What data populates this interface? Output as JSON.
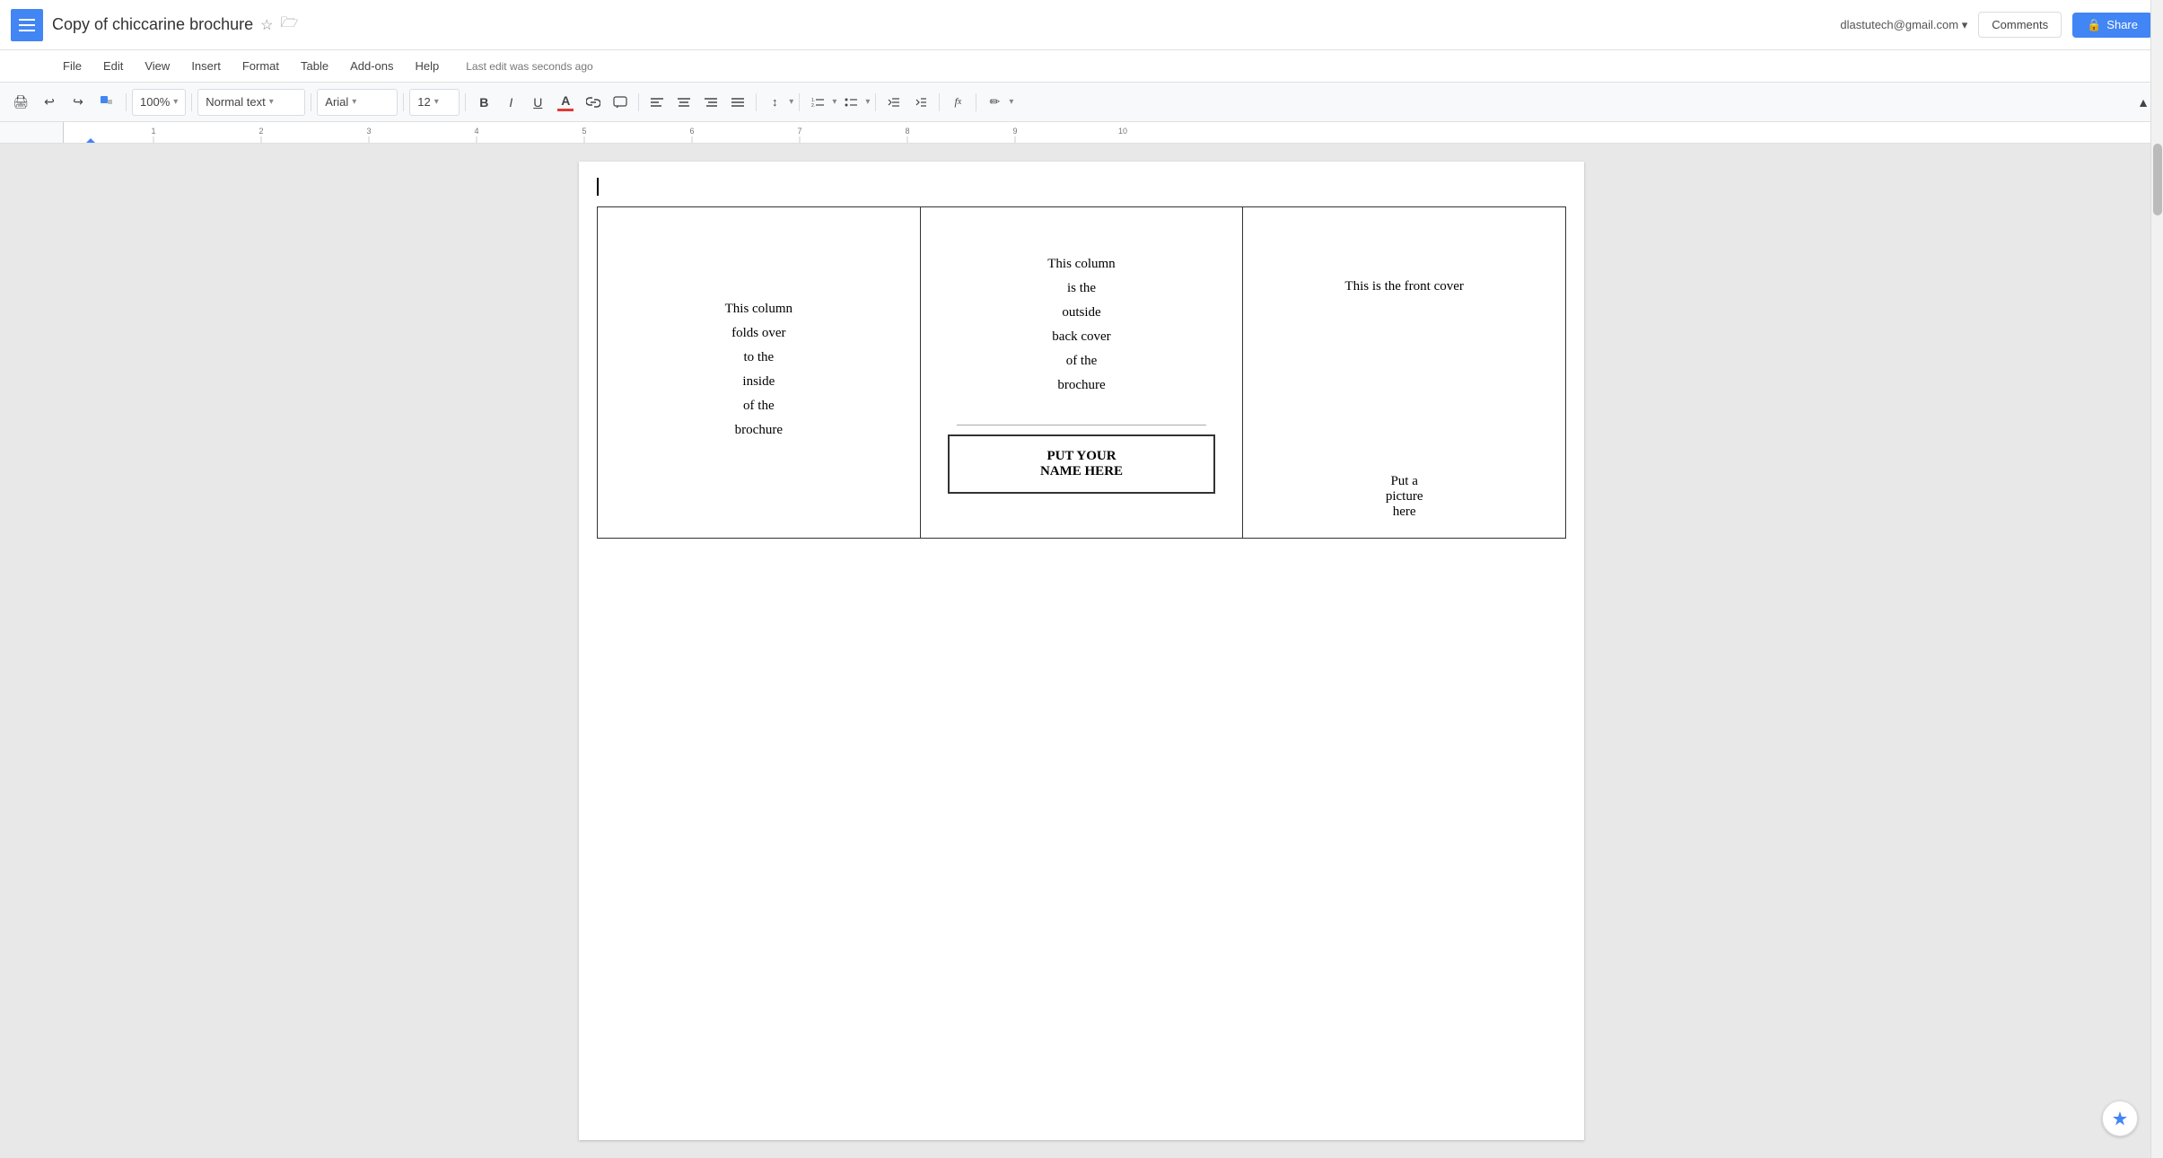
{
  "app": {
    "menu_icon": "≡",
    "title": "Copy of chiccarine brochure",
    "star": "☆",
    "folder": "🗁"
  },
  "topRight": {
    "user_email": "dlastutech@gmail.com",
    "email_arrow": "▾",
    "comments_label": "Comments",
    "lock_icon": "🔒",
    "share_label": "Share"
  },
  "menuBar": {
    "items": [
      "File",
      "Edit",
      "View",
      "Insert",
      "Format",
      "Table",
      "Add-ons",
      "Help"
    ],
    "last_edit": "Last edit was seconds ago"
  },
  "toolbar": {
    "print": "🖨",
    "undo": "↩",
    "redo": "↪",
    "paint_format": "🎨",
    "zoom_value": "100%",
    "zoom_arrow": "▾",
    "style_value": "Normal text",
    "style_arrow": "▾",
    "font_value": "Arial",
    "font_arrow": "▾",
    "size_value": "12",
    "size_arrow": "▾",
    "bold": "B",
    "italic": "I",
    "underline": "U",
    "text_color_letter": "A",
    "link": "🔗",
    "comment": "💬",
    "align_left": "≡",
    "align_center": "≡",
    "align_right": "≡",
    "align_justify": "≡",
    "line_spacing": "↕",
    "num_list": "☰",
    "bullet_list": "☰",
    "indent_less": "←",
    "indent_more": "→",
    "clear_format": "fx",
    "pen_icon": "✏",
    "collapse_icon": "▲"
  },
  "document": {
    "col1": {
      "lines": [
        "This column",
        "folds over",
        "to the",
        "inside",
        "of the",
        "brochure"
      ]
    },
    "col2": {
      "top_lines": [
        "This column",
        "is the",
        "outside",
        "back cover",
        "of the",
        "brochure"
      ],
      "name_box": [
        "PUT YOUR",
        "NAME HERE"
      ]
    },
    "col3": {
      "title": "This is the front cover",
      "bottom_lines": [
        "Put a",
        "picture",
        "here"
      ]
    }
  }
}
